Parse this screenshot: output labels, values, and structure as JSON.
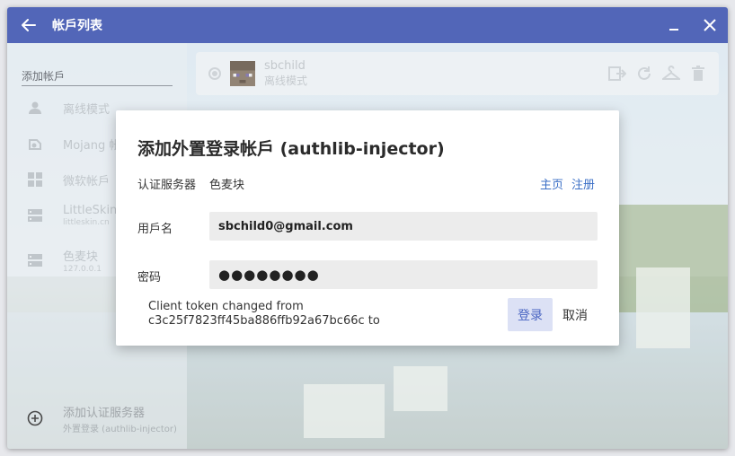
{
  "window": {
    "title": "帐戶列表"
  },
  "sidebar": {
    "section_title": "添加帐戶",
    "items": [
      {
        "label": "离线模式",
        "sub": ""
      },
      {
        "label": "Mojang 帐戶",
        "sub": ""
      },
      {
        "label": "微软帐戶",
        "sub": ""
      },
      {
        "label": "LittleSkin",
        "sub": "littleskin.cn"
      },
      {
        "label": "色麦块",
        "sub": "127.0.0.1"
      }
    ],
    "add_server": {
      "label": "添加认证服务器",
      "sub": "外置登录 (authlib-injector)"
    }
  },
  "account": {
    "name": "sbchild",
    "type": "离线模式"
  },
  "dialog": {
    "title": "添加外置登录帐戶 (authlib-injector)",
    "server_label": "认证服务器",
    "server_value": "色麦块",
    "link_home": "主页",
    "link_register": "注册",
    "username_label": "用戶名",
    "username_value": "sbchild0@gmail.com",
    "password_label": "密码",
    "password_value": "●●●●●●●●",
    "message_line1": "Client token changed from",
    "message_line2": "c3c25f7823ff45ba886ffb92a67bc66c to",
    "login_button": "登录",
    "cancel_button": "取消"
  },
  "colors": {
    "titlebar": "#5266b8",
    "accent": "#3b6fc6"
  }
}
